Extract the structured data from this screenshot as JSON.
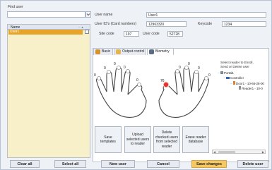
{
  "find_user_label": "Find user",
  "list": {
    "column_name": "Name",
    "rows": [
      {
        "name": "User1"
      }
    ]
  },
  "form": {
    "user_name_label": "User name",
    "user_name_value": "User1",
    "user_ids_label": "User ID's (Card numbers)",
    "user_ids_value": "12963320",
    "keycode_label": "Keycode",
    "keycode_value": "1234",
    "site_code_label": "Site code",
    "site_code_value": "197",
    "user_code_label": "User code",
    "user_code_value": "52728"
  },
  "tabs": [
    {
      "label": "Basic",
      "icon": "user-icon",
      "color": "#d8922a"
    },
    {
      "label": "Output control",
      "icon": "output-icon",
      "color": "#e3b54a"
    },
    {
      "label": "Biometry",
      "icon": "fingerprint-icon",
      "color": "#5a6b82"
    }
  ],
  "biometry": {
    "finger_counts": [
      "0",
      "0",
      "0",
      "0",
      "0",
      "76",
      "0",
      "0",
      "0",
      "0"
    ],
    "selected_finger_color": "#e0342f",
    "instruction": [
      "Select reader to Enroll,",
      "Send or Delete user"
    ],
    "tree": {
      "root": "Portal1",
      "controller": "Controller",
      "door": "Door1 - 10-65-28-00",
      "reader": "Reader1 - 10-0"
    }
  },
  "action_buttons": [
    {
      "label": "Save templates"
    },
    {
      "label": "Upload selected users to reader"
    },
    {
      "label": "Delete checked users from selected reader"
    },
    {
      "label": "Erase reader database"
    }
  ],
  "bottom_buttons": {
    "clear_all": "Clear all",
    "select_all": "Select all",
    "new_user": "New user",
    "cancel": "Cancel",
    "save_changes": "Save changes",
    "delete_user": "Delete user"
  }
}
